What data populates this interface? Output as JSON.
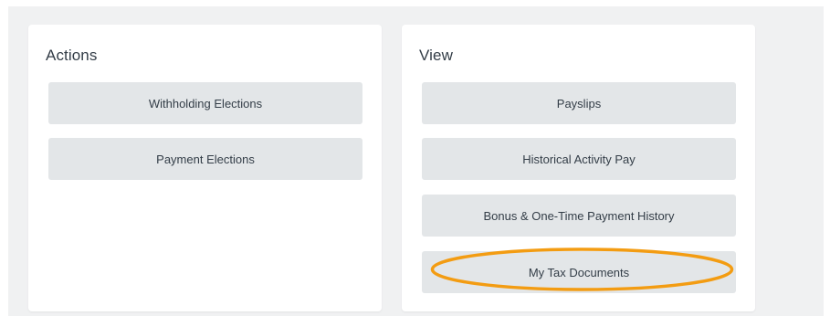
{
  "actions": {
    "title": "Actions",
    "buttons": [
      {
        "label": "Withholding Elections"
      },
      {
        "label": "Payment Elections"
      }
    ]
  },
  "view": {
    "title": "View",
    "buttons": [
      {
        "label": "Payslips"
      },
      {
        "label": "Historical Activity Pay"
      },
      {
        "label": "Bonus & One-Time Payment History"
      },
      {
        "label": "My Tax Documents"
      }
    ]
  },
  "highlight": {
    "target": "My Tax Documents",
    "color": "#f39c12"
  },
  "colors": {
    "panel_background": "#f0f1f2",
    "card_background": "#ffffff",
    "button_background": "#e3e6e8",
    "text": "#333d47"
  }
}
